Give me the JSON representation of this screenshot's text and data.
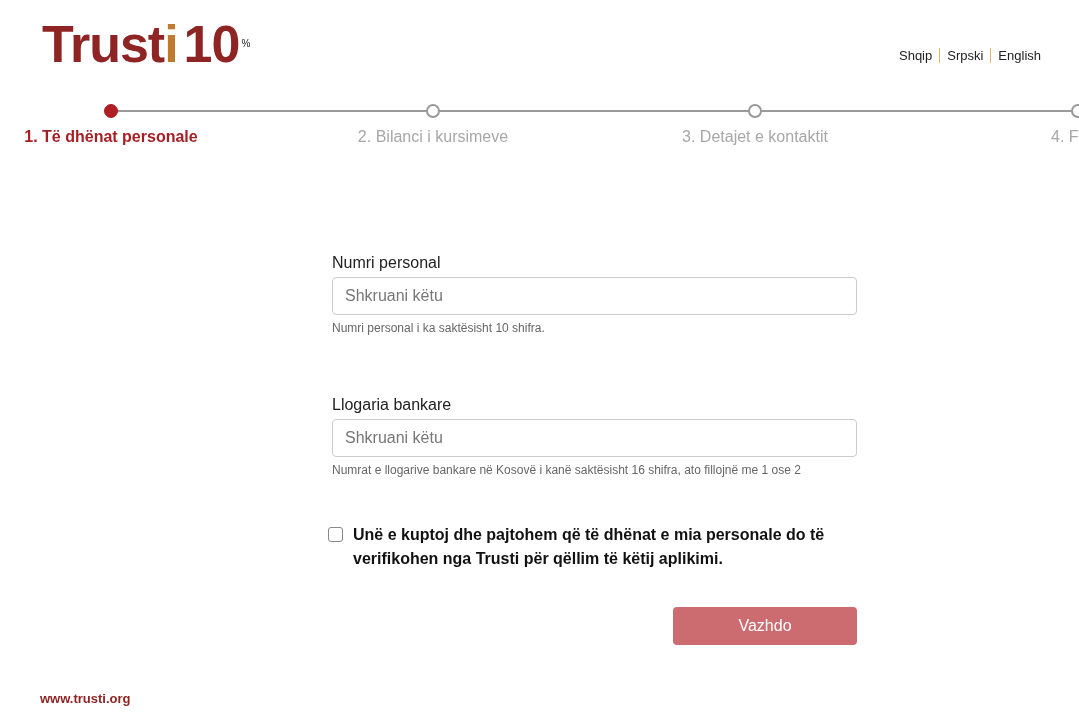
{
  "logo": {
    "main": "Trust",
    "accent": "i",
    "number": "10",
    "sup": "%"
  },
  "languages": [
    "Shqip",
    "Srpski",
    "English"
  ],
  "steps": [
    {
      "label": "1. Të dhënat personale",
      "selected": true
    },
    {
      "label": "2. Bilanci i kursimeve",
      "selected": false
    },
    {
      "label": "3. Detajet e kontaktit",
      "selected": false
    },
    {
      "label": "4. F",
      "selected": false
    }
  ],
  "fields": [
    {
      "label": "Numri personal",
      "placeholder": "Shkruani këtu",
      "help": "Numri personal i ka saktësisht 10 shifra."
    },
    {
      "label": "Llogaria bankare",
      "placeholder": "Shkruani këtu",
      "help": "Numrat e llogarive bankare në Kosovë i kanë saktësisht 16 shifra, ato fillojnë me 1 ose 2"
    }
  ],
  "consent": {
    "checked": false,
    "text": "Unë e kuptoj dhe pajtohem që të dhënat e mia personale do të verifikohen nga Trusti për qëllim të këtij aplikimi."
  },
  "submit": {
    "label": "Vazhdo",
    "disabled": true
  },
  "footer": "www.trusti.org"
}
